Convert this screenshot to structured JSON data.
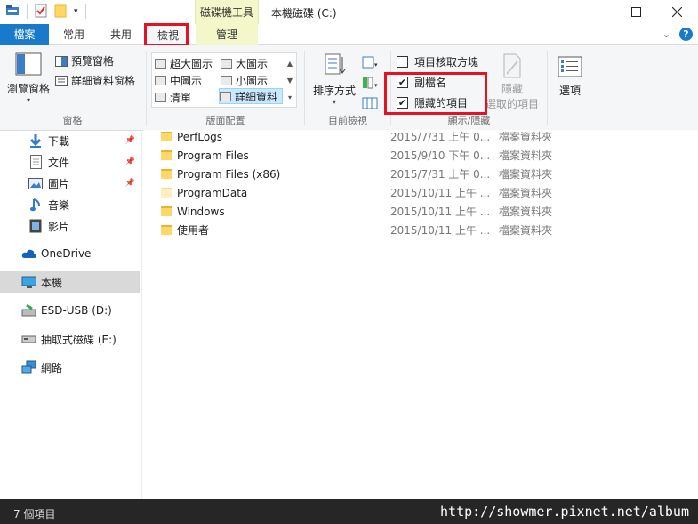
{
  "window": {
    "title": "本機磁碟 (C:)",
    "context_tab": "磁碟機工具",
    "minimize_icon": "minimize-icon",
    "maximize_icon": "maximize-icon",
    "close_icon": "close-icon"
  },
  "tabs": {
    "file": "檔案",
    "home": "常用",
    "share": "共用",
    "view": "檢視",
    "manage": "管理"
  },
  "ribbon": {
    "panes": {
      "navigation_pane": "瀏覽窗格",
      "preview_pane": "預覽窗格",
      "details_pane": "詳細資料窗格",
      "label": "窗格"
    },
    "layout": {
      "extra_large": "超大圖示",
      "large": "大圖示",
      "medium": "中圖示",
      "small": "小圖示",
      "list": "清單",
      "details": "詳細資料",
      "label": "版面配置"
    },
    "current_view": {
      "sort_by": "排序方式",
      "label": "目前檢視"
    },
    "show_hide": {
      "item_checkboxes": "項目核取方塊",
      "item_checkboxes_checked": false,
      "file_extensions": "副檔名",
      "file_extensions_checked": true,
      "hidden_items": "隱藏的項目",
      "hidden_items_checked": true,
      "hide_selected_line1": "隱藏",
      "hide_selected_line2": "選取的項目",
      "label": "顯示/隱藏"
    },
    "options": {
      "label": "選項"
    }
  },
  "nav": {
    "items": [
      {
        "label": "下載",
        "icon": "download-icon",
        "pinned": true
      },
      {
        "label": "文件",
        "icon": "document-icon",
        "pinned": true
      },
      {
        "label": "圖片",
        "icon": "picture-icon",
        "pinned": true
      },
      {
        "label": "音樂",
        "icon": "music-icon",
        "pinned": false
      },
      {
        "label": "影片",
        "icon": "video-icon",
        "pinned": false
      },
      {
        "label": "OneDrive",
        "icon": "cloud-icon",
        "pinned": false
      },
      {
        "label": "本機",
        "icon": "computer-icon",
        "pinned": false
      },
      {
        "label": "ESD-USB (D:)",
        "icon": "usb-drive-icon",
        "pinned": false
      },
      {
        "label": "抽取式磁碟 (E:)",
        "icon": "removable-drive-icon",
        "pinned": false
      },
      {
        "label": "網路",
        "icon": "network-icon",
        "pinned": false
      }
    ]
  },
  "files": [
    {
      "name": "PerfLogs",
      "date": "2015/7/31 上午 0...",
      "type": "檔案資料夾"
    },
    {
      "name": "Program Files",
      "date": "2015/9/10 下午 0...",
      "type": "檔案資料夾"
    },
    {
      "name": "Program Files (x86)",
      "date": "2015/7/31 上午 0...",
      "type": "檔案資料夾"
    },
    {
      "name": "ProgramData",
      "date": "2015/10/11 上午 ...",
      "type": "檔案資料夾"
    },
    {
      "name": "Windows",
      "date": "2015/10/11 上午 ...",
      "type": "檔案資料夾"
    },
    {
      "name": "使用者",
      "date": "2015/10/11 上午 ...",
      "type": "檔案資料夾"
    }
  ],
  "status": {
    "count": "7 個項目",
    "watermark": "http://showmer.pixnet.net/album"
  },
  "colors": {
    "accent": "#1979ca",
    "highlight_box": "#e81123",
    "context_tab_bg": "#f3f7c9"
  }
}
